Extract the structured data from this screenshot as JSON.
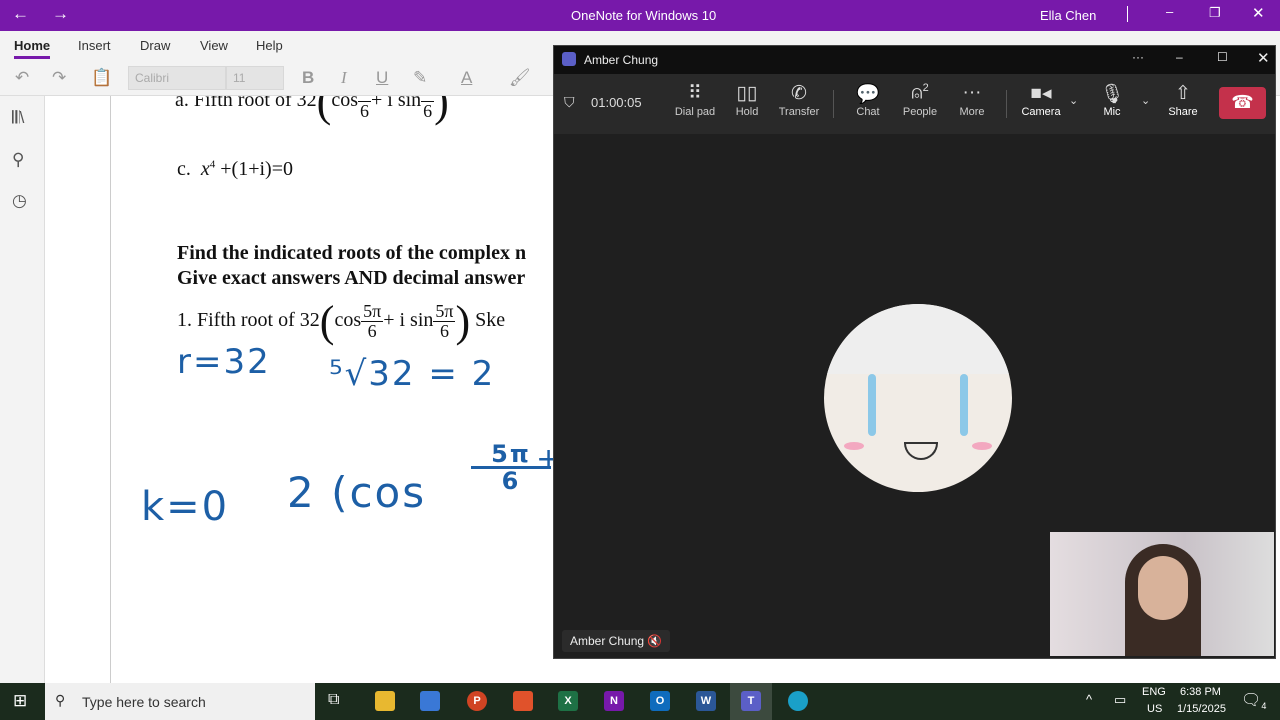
{
  "app": {
    "title": "OneNote for Windows 10",
    "user": "Ella Chen"
  },
  "ribbon": {
    "tabs": [
      "Home",
      "Insert",
      "Draw",
      "View",
      "Help"
    ],
    "font": "Calibri",
    "size": "11",
    "bold": "B",
    "italic": "I",
    "underline": "U",
    "font_color": "A"
  },
  "page": {
    "a_label": "a.  Fifth root of 32",
    "six": "6",
    "c_label": "c.",
    "c_expr": "+(1+i)=0",
    "x": "x",
    "four": "4",
    "heading1": "Find the indicated roots of the complex n",
    "heading2": "Give exact answers AND decimal answer",
    "q1_label": "1.  Fifth root of 32",
    "cos": "cos",
    "isin": "+ i sin",
    "fivepi": "5π",
    "sketch": "Ske",
    "hand1": "r=32",
    "hand2": "⁵√32 = 2",
    "hand3": "k=0",
    "hand4": "2 (cos",
    "hand5": "5π",
    "hand6": "6",
    "hand7": "+"
  },
  "teams": {
    "title": "Amber Chung",
    "timer": "01:00:05",
    "buttons": [
      {
        "label": "Dial pad",
        "icon": "dialpad-icon"
      },
      {
        "label": "Hold",
        "icon": "hold-icon"
      },
      {
        "label": "Transfer",
        "icon": "transfer-icon"
      },
      {
        "label": "Chat",
        "icon": "chat-icon"
      },
      {
        "label": "People",
        "icon": "people-icon",
        "count": "2"
      },
      {
        "label": "More",
        "icon": "more-icon"
      },
      {
        "label": "Camera",
        "icon": "camera-icon"
      },
      {
        "label": "Mic",
        "icon": "mic-icon"
      },
      {
        "label": "Share",
        "icon": "share-icon"
      }
    ],
    "participant": "Amber Chung",
    "hangup_color": "#c4314b"
  },
  "taskbar": {
    "search_placeholder": "Type here to search",
    "lang1": "ENG",
    "lang2": "US",
    "time": "6:38 PM",
    "date": "1/15/2025",
    "notifications": "4"
  },
  "colors": {
    "onenote": "#7719aa",
    "ink": "#1d5fa6"
  }
}
